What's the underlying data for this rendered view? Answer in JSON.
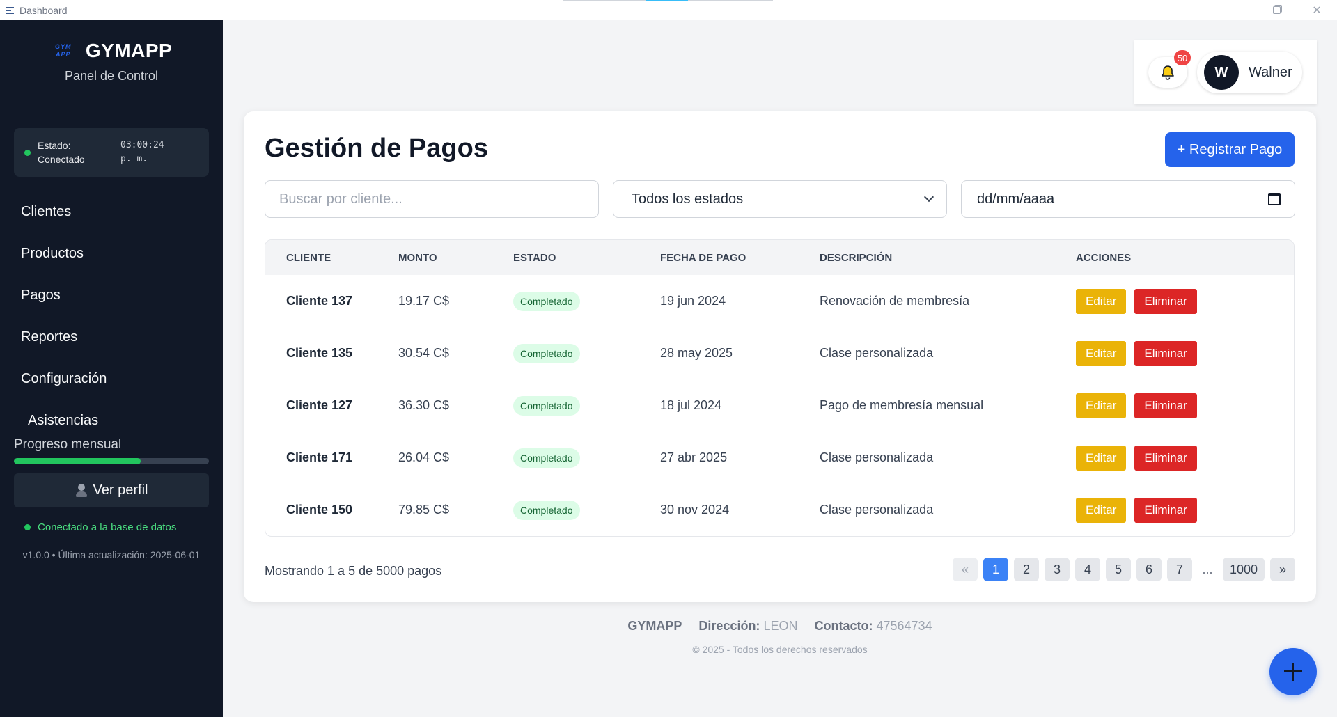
{
  "window": {
    "title": "Dashboard"
  },
  "brand": {
    "logo_text": "GYM APP",
    "name": "GYMAPP",
    "subtitle": "Panel de Control"
  },
  "status": {
    "label": "Estado: Conectado",
    "time": "03:00:24 p. m."
  },
  "nav": [
    {
      "label": "Clientes"
    },
    {
      "label": "Productos"
    },
    {
      "label": "Pagos"
    },
    {
      "label": "Reportes"
    },
    {
      "label": "Configuración"
    },
    {
      "label": "Asistencias"
    }
  ],
  "progress": {
    "label": "Progreso mensual",
    "value_fraction": 0.65
  },
  "profile_button": {
    "label": "Ver perfil"
  },
  "db_status": {
    "text": "Conectado a la base de datos"
  },
  "version": {
    "text": "v1.0.0 • Última actualización: 2025-06-01"
  },
  "header": {
    "notifications_count": "50",
    "user_initial": "W",
    "user_name": "Walner"
  },
  "page": {
    "title": "Gestión de Pagos",
    "register_button": "+ Registrar Pago"
  },
  "filters": {
    "search_placeholder": "Buscar por cliente...",
    "status_selected": "Todos los estados",
    "date_placeholder": "dd/mm/aaaa"
  },
  "table": {
    "headers": [
      "CLIENTE",
      "MONTO",
      "ESTADO",
      "FECHA DE PAGO",
      "DESCRIPCIÓN",
      "ACCIONES"
    ],
    "rows": [
      {
        "cliente": "Cliente 137",
        "monto": "19.17 C$",
        "estado": "Completado",
        "fecha": "19 jun 2024",
        "descripcion": "Renovación de membresía"
      },
      {
        "cliente": "Cliente 135",
        "monto": "30.54 C$",
        "estado": "Completado",
        "fecha": "28 may 2025",
        "descripcion": "Clase personalizada"
      },
      {
        "cliente": "Cliente 127",
        "monto": "36.30 C$",
        "estado": "Completado",
        "fecha": "18 jul 2024",
        "descripcion": "Pago de membresía mensual"
      },
      {
        "cliente": "Cliente 171",
        "monto": "26.04 C$",
        "estado": "Completado",
        "fecha": "27 abr 2025",
        "descripcion": "Clase personalizada"
      },
      {
        "cliente": "Cliente 150",
        "monto": "79.85 C$",
        "estado": "Completado",
        "fecha": "30 nov 2024",
        "descripcion": "Clase personalizada"
      }
    ],
    "edit_label": "Editar",
    "delete_label": "Eliminar"
  },
  "pagination": {
    "showing": "Mostrando 1 a 5 de 5000 pagos",
    "prev": "«",
    "pages": [
      "1",
      "2",
      "3",
      "4",
      "5",
      "6",
      "7"
    ],
    "ellipsis": "...",
    "last": "1000",
    "next": "»",
    "current": "1"
  },
  "footer": {
    "brand": "GYMAPP",
    "address_label": "Dirección:",
    "address_value": "LEON",
    "contact_label": "Contacto:",
    "contact_value": "47564734",
    "copyright": "© 2025 - Todos los derechos reservados"
  },
  "colors": {
    "sidebar": "#111827",
    "primary": "#2563eb",
    "edit": "#eab308",
    "delete": "#dc2626",
    "success": "#22c55e"
  }
}
